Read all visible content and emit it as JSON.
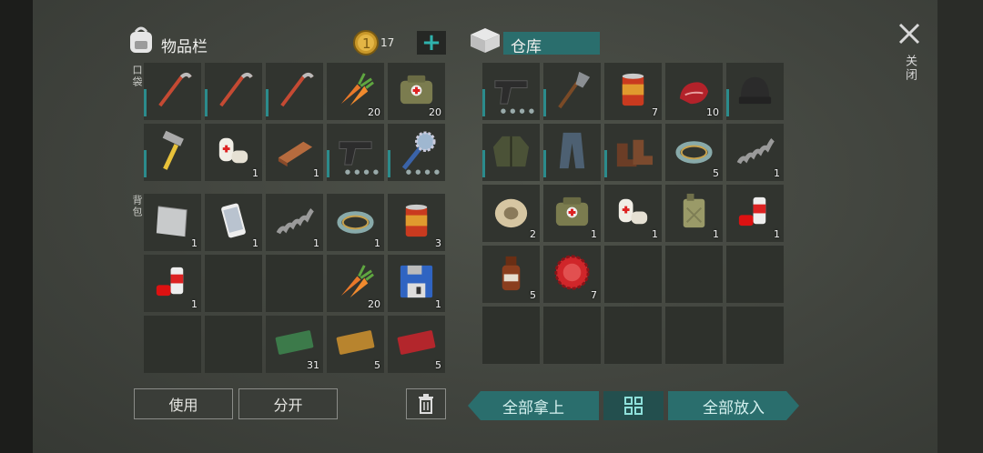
{
  "inventory": {
    "title": "物品栏",
    "coins": "17",
    "pocket_label": "口袋",
    "backpack_label": "背包",
    "pocket_slots": [
      {
        "icon": "crowbar-icon",
        "count": ""
      },
      {
        "icon": "crowbar-icon",
        "count": ""
      },
      {
        "icon": "crowbar-icon",
        "count": ""
      },
      {
        "icon": "carrot-icon",
        "count": "20"
      },
      {
        "icon": "first-aid-bag-icon",
        "count": "20"
      },
      {
        "icon": "hammer-icon",
        "count": ""
      },
      {
        "icon": "bandage-icon",
        "count": "1"
      },
      {
        "icon": "copper-ingot-icon",
        "count": "1"
      },
      {
        "icon": "pistol-icon",
        "count": ""
      },
      {
        "icon": "saw-mace-icon",
        "count": ""
      }
    ],
    "backpack_slots": [
      {
        "icon": "metal-sheet-icon",
        "count": "1"
      },
      {
        "icon": "smartphone-icon",
        "count": "1"
      },
      {
        "icon": "spring-icon",
        "count": "1"
      },
      {
        "icon": "wire-coil-icon",
        "count": "1"
      },
      {
        "icon": "food-can-icon",
        "count": "3"
      },
      {
        "icon": "spray-can-icon",
        "count": "1"
      },
      {
        "icon": "",
        "count": ""
      },
      {
        "icon": "",
        "count": ""
      },
      {
        "icon": "carrot-icon",
        "count": "20"
      },
      {
        "icon": "floppy-disk-icon",
        "count": "1"
      },
      {
        "icon": "",
        "count": ""
      },
      {
        "icon": "",
        "count": ""
      },
      {
        "icon": "ration-coupon-icon",
        "count": "31"
      },
      {
        "icon": "ammo-coupon-icon",
        "count": "5"
      },
      {
        "icon": "combat-gear-coupon-icon",
        "count": "5"
      }
    ],
    "use_label": "使用",
    "split_label": "分开"
  },
  "storage": {
    "title": "仓库",
    "slots": [
      {
        "icon": "pistol-icon",
        "count": ""
      },
      {
        "icon": "shovel-icon",
        "count": ""
      },
      {
        "icon": "food-can-icon",
        "count": "7"
      },
      {
        "icon": "raw-meat-icon",
        "count": "10"
      },
      {
        "icon": "beanie-icon",
        "count": ""
      },
      {
        "icon": "jacket-icon",
        "count": ""
      },
      {
        "icon": "pants-icon",
        "count": ""
      },
      {
        "icon": "boots-icon",
        "count": ""
      },
      {
        "icon": "wire-coil-icon",
        "count": "5"
      },
      {
        "icon": "spring-icon",
        "count": "1"
      },
      {
        "icon": "wire-spool-icon",
        "count": "2"
      },
      {
        "icon": "first-aid-bag-icon",
        "count": "1"
      },
      {
        "icon": "bandage-icon",
        "count": "1"
      },
      {
        "icon": "jerrycan-icon",
        "count": "1"
      },
      {
        "icon": "spray-can-icon",
        "count": "1"
      },
      {
        "icon": "medicine-bottle-icon",
        "count": "5"
      },
      {
        "icon": "bottle-cap-icon",
        "count": "7"
      },
      {
        "icon": "",
        "count": ""
      },
      {
        "icon": "",
        "count": ""
      },
      {
        "icon": "",
        "count": ""
      },
      {
        "icon": "",
        "count": ""
      },
      {
        "icon": "",
        "count": ""
      },
      {
        "icon": "",
        "count": ""
      },
      {
        "icon": "",
        "count": ""
      },
      {
        "icon": "",
        "count": ""
      }
    ],
    "take_all_label": "全部拿上",
    "put_all_label": "全部放入"
  },
  "close_label": "关闭",
  "colors": {
    "accent": "#2a6e6d",
    "text": "#e8e8e4",
    "slot": "#2e312c"
  }
}
